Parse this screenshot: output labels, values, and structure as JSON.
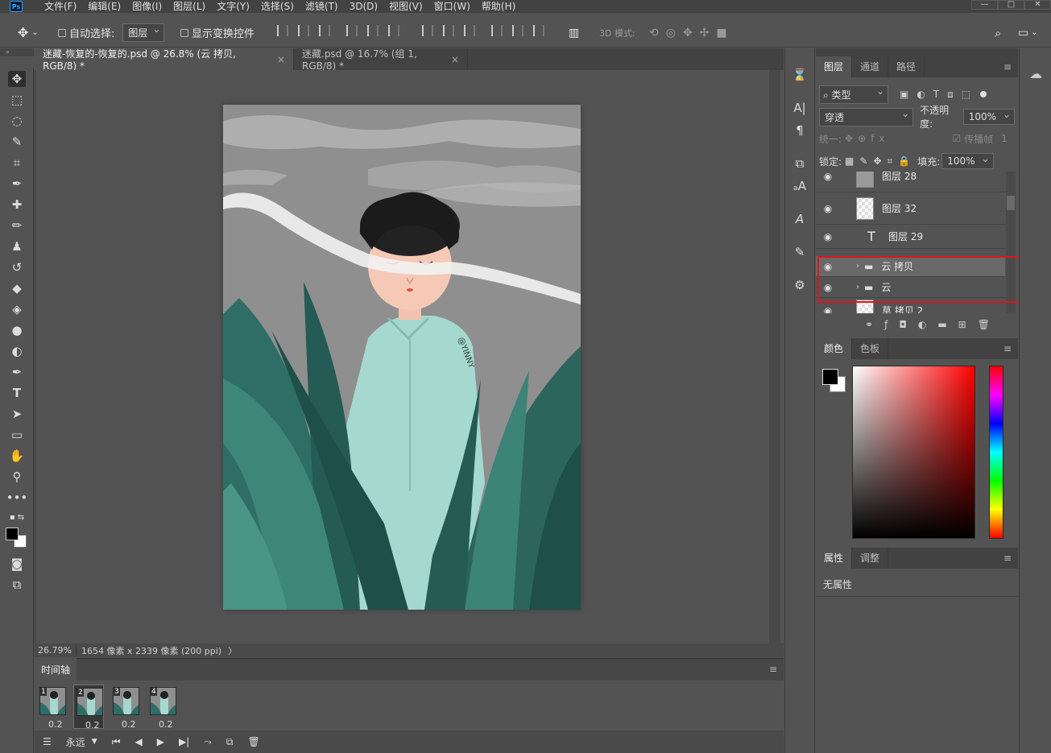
{
  "app": {
    "logo": "Ps"
  },
  "menu": [
    "文件(F)",
    "编辑(E)",
    "图像(I)",
    "图层(L)",
    "文字(Y)",
    "选择(S)",
    "滤镜(T)",
    "3D(D)",
    "视图(V)",
    "窗口(W)",
    "帮助(H)"
  ],
  "window_controls": [
    "—",
    "□",
    "✕"
  ],
  "options": {
    "auto_select_label": "自动选择:",
    "auto_select_value": "图层",
    "show_transform_label": "显示变换控件",
    "mode_3d_label": "3D 模式:"
  },
  "tabs": [
    {
      "title": "迷藏-恢复的-恢复的.psd @ 26.8% (云 拷贝, RGB/8) *",
      "close": "×"
    },
    {
      "title": "迷藏.psd @ 16.7% (组 1, RGB/8) *",
      "close": "×"
    }
  ],
  "status": {
    "zoom": "26.79%",
    "doc_info": "1654 像素 x 2339 像素 (200 ppi)",
    "arrow": "〉"
  },
  "artwork": {
    "signature": "@YINNY"
  },
  "timeline": {
    "tab": "时间轴",
    "frames": [
      {
        "num": "1",
        "delay": "0.2"
      },
      {
        "num": "2",
        "delay": "0.2"
      },
      {
        "num": "3",
        "delay": "0.2"
      },
      {
        "num": "4",
        "delay": "0.2"
      }
    ],
    "loop": "永远"
  },
  "layers_panel": {
    "tabs": [
      "图层",
      "通道",
      "路径"
    ],
    "filter_label": "类型",
    "blend_mode": "穿透",
    "opacity_label": "不透明度:",
    "opacity_value": "100%",
    "unify_label": "统一:",
    "propagate_label": "传播帧",
    "propagate_value": "1",
    "lock_label": "锁定:",
    "fill_label": "填充:",
    "fill_value": "100%",
    "layers": [
      {
        "name": "图层 28",
        "type": "pixel"
      },
      {
        "name": "图层 32",
        "type": "pixel"
      },
      {
        "name": "图层 29",
        "type": "text"
      },
      {
        "name": "云 拷贝",
        "type": "group"
      },
      {
        "name": "云",
        "type": "group"
      },
      {
        "name": "草 拷贝 2",
        "type": "pixel"
      }
    ]
  },
  "color_panel": {
    "tabs": [
      "颜色",
      "色板"
    ],
    "foreground": "#000000",
    "background": "#ffffff"
  },
  "properties_panel": {
    "tabs": [
      "属性",
      "调整"
    ],
    "empty_text": "无属性"
  },
  "highlight_color": "#e0141e"
}
